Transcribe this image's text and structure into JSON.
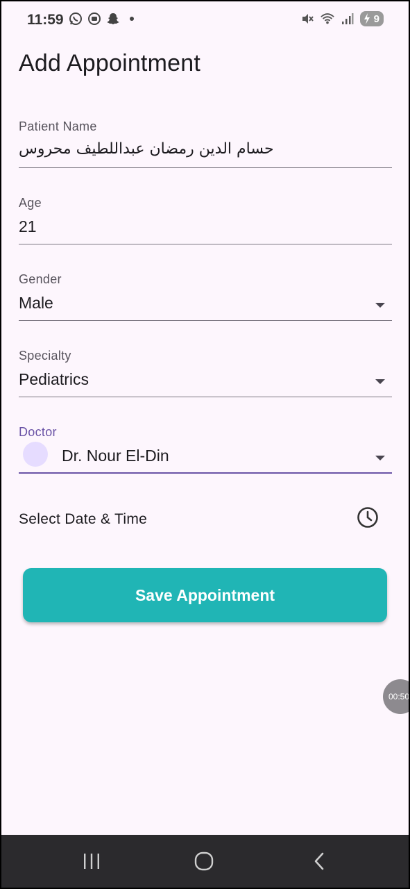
{
  "status_bar": {
    "time": "11:59",
    "battery": "9",
    "left_icons": [
      "whatsapp-icon",
      "message-icon",
      "snapchat-icon",
      "dot-icon"
    ],
    "right_icons": [
      "mute-icon",
      "wifi-icon",
      "signal-icon",
      "battery-icon"
    ]
  },
  "page": {
    "title": "Add Appointment"
  },
  "form": {
    "patient_name": {
      "label": "Patient Name",
      "value": "حسام الدين رمضان عبداللطيف محروس"
    },
    "age": {
      "label": "Age",
      "value": "21"
    },
    "gender": {
      "label": "Gender",
      "value": "Male"
    },
    "specialty": {
      "label": "Specialty",
      "value": "Pediatrics"
    },
    "doctor": {
      "label": "Doctor",
      "value": "Dr. Nour El-Din"
    },
    "datetime": {
      "label": "Select Date & Time"
    },
    "save_label": "Save Appointment"
  },
  "timer": "00:50",
  "colors": {
    "accent": "#6a53a6",
    "button": "#20b5b5",
    "background": "#fdf6fd"
  }
}
